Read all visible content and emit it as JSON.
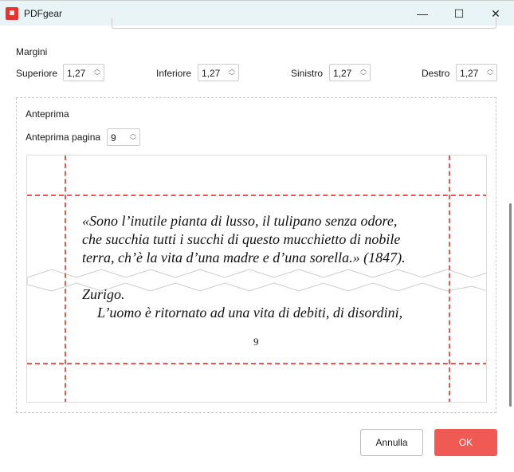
{
  "window": {
    "title": "PDFgear",
    "logo_text": "PDF"
  },
  "margins": {
    "heading": "Margini",
    "fields": [
      {
        "label": "Superiore",
        "value": "1,27"
      },
      {
        "label": "Inferiore",
        "value": "1,27"
      },
      {
        "label": "Sinistro",
        "value": "1,27"
      },
      {
        "label": "Destro",
        "value": "1,27"
      }
    ]
  },
  "preview": {
    "heading": "Anteprima",
    "page_label": "Anteprima pagina",
    "page_value": "9",
    "lines": [
      "«Sono l’inutile pianta di lusso, il tulipano senza odore,",
      "che succhia tutti i succhi di questo mucchietto di nobile",
      "terra, ch’è la vita d’una madre e d’una sorella.» (1847).",
      "Zurigo.",
      "L’uomo è ritornato ad una vita di debiti, di disordini,"
    ],
    "page_number": "9"
  },
  "buttons": {
    "cancel": "Annulla",
    "ok": "OK"
  },
  "colors": {
    "accent": "#f05a55",
    "margin_line": "#ec5454"
  }
}
